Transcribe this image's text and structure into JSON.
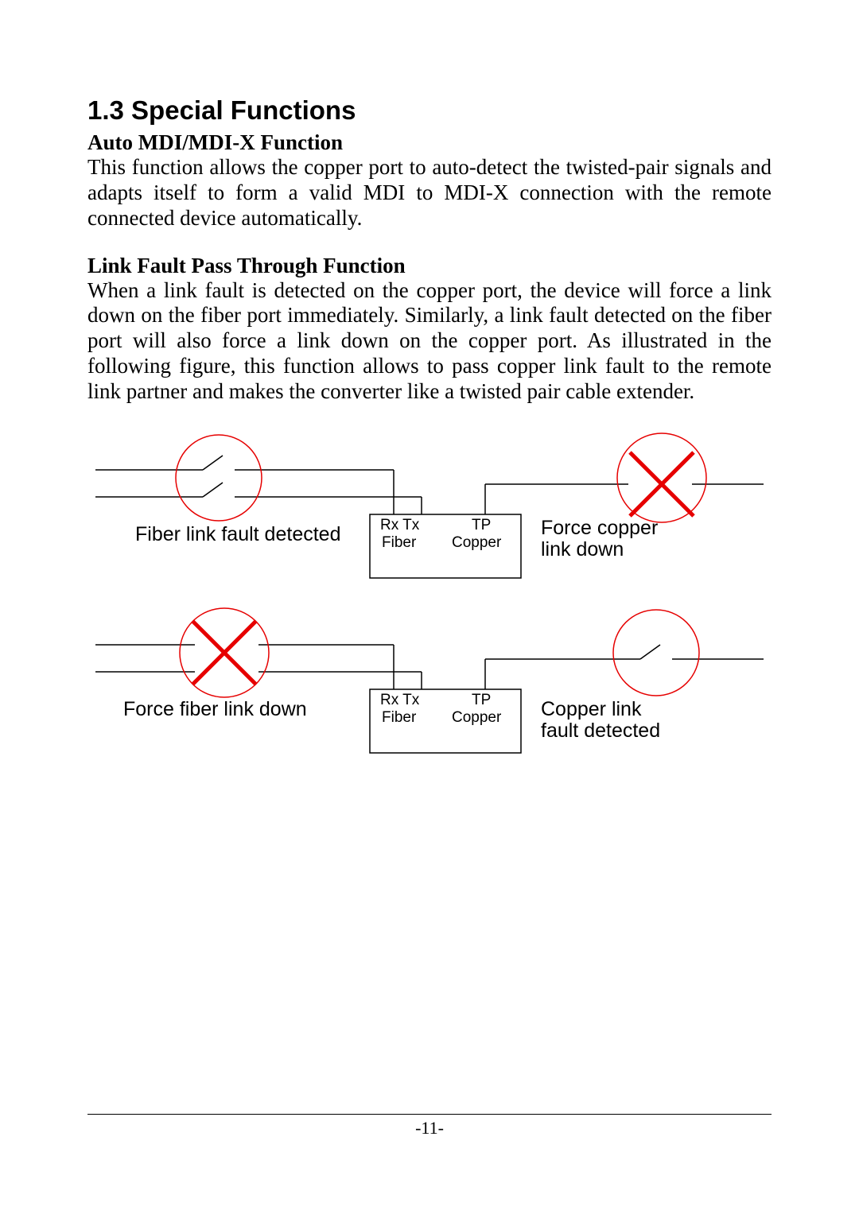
{
  "heading": "1.3 Special Functions",
  "section1": {
    "title": "Auto MDI/MDI-X Function",
    "body": "This function allows the copper port to auto-detect the twisted-pair signals  and adapts itself to form a valid MDI to MDI-X connection with the remote connected device automatically."
  },
  "section2": {
    "title": "Link Fault Pass Through Function",
    "body": "When a link fault is detected on the copper port, the device will force a link down on the fiber port immediately. Similarly, a link fault detected on the fiber port will also force a link down on the copper port. As illustrated in the following figure, this function allows to pass copper link fault to the remote link partner and makes the converter like a twisted pair cable extender."
  },
  "diagram": {
    "top": {
      "left_label": "Fiber link fault detected",
      "right_label": "Force copper link down",
      "box_rx_tx": "Rx Tx",
      "box_fiber": "Fiber",
      "box_tp": "TP",
      "box_copper": "Copper"
    },
    "bottom": {
      "left_label": "Force fiber link down",
      "right_label": "Copper link fault detected",
      "box_rx_tx": "Rx Tx",
      "box_fiber": "Fiber",
      "box_tp": "TP",
      "box_copper": "Copper"
    }
  },
  "page_number": "-11-"
}
